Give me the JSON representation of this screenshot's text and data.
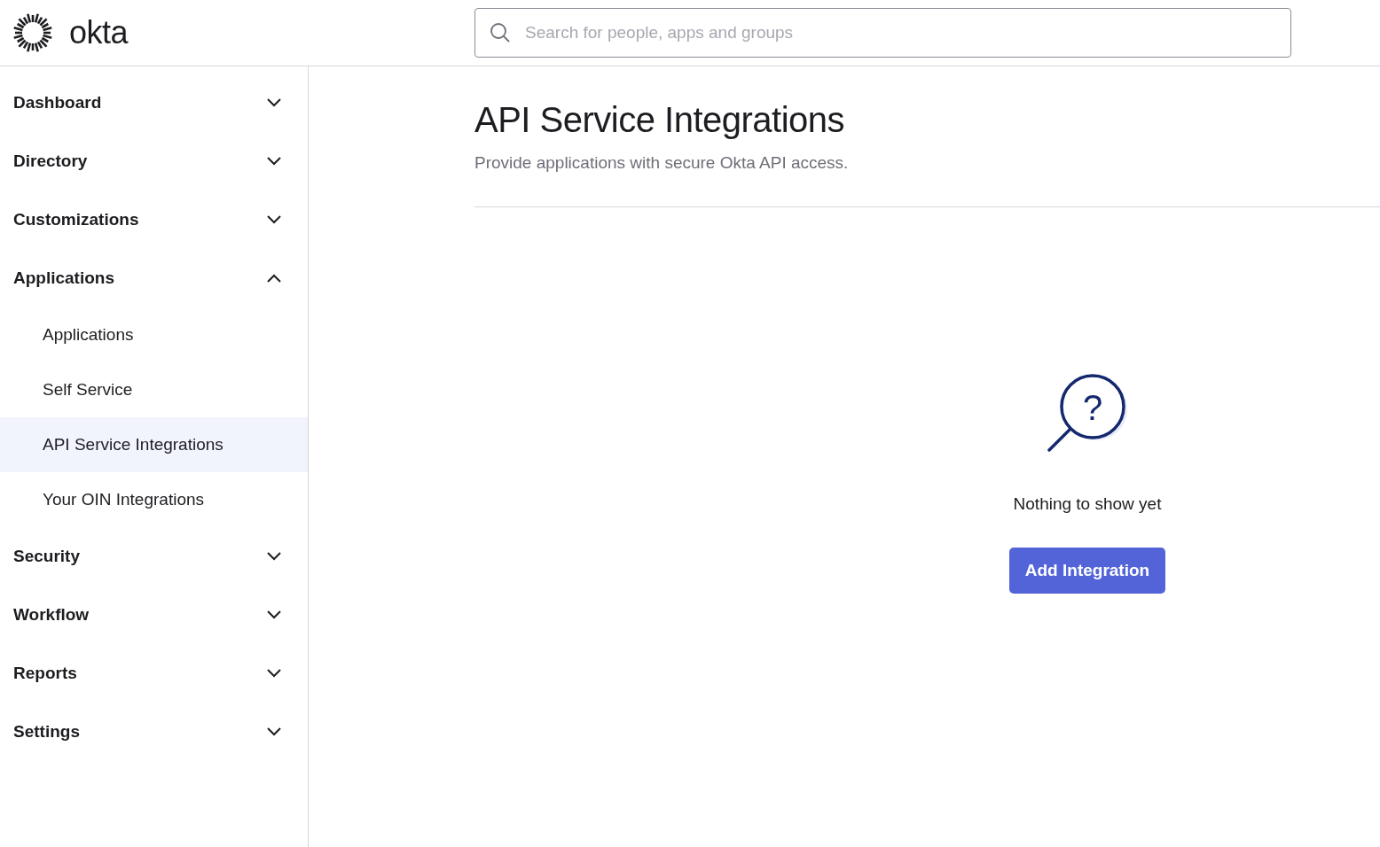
{
  "header": {
    "logo_text": "okta",
    "search": {
      "placeholder": "Search for people, apps and groups"
    }
  },
  "sidebar": {
    "items": [
      {
        "label": "Dashboard",
        "expanded": false
      },
      {
        "label": "Directory",
        "expanded": false
      },
      {
        "label": "Customizations",
        "expanded": false
      },
      {
        "label": "Applications",
        "expanded": true,
        "children": [
          {
            "label": "Applications",
            "selected": false
          },
          {
            "label": "Self Service",
            "selected": false
          },
          {
            "label": "API Service Integrations",
            "selected": true
          },
          {
            "label": "Your OIN Integrations",
            "selected": false
          }
        ]
      },
      {
        "label": "Security",
        "expanded": false
      },
      {
        "label": "Workflow",
        "expanded": false
      },
      {
        "label": "Reports",
        "expanded": false
      },
      {
        "label": "Settings",
        "expanded": false
      }
    ]
  },
  "page": {
    "title": "API Service Integrations",
    "subtitle": "Provide applications with secure Okta API access.",
    "empty_state": {
      "icon_text": "?",
      "message": "Nothing to show yet",
      "button": "Add Integration"
    }
  }
}
